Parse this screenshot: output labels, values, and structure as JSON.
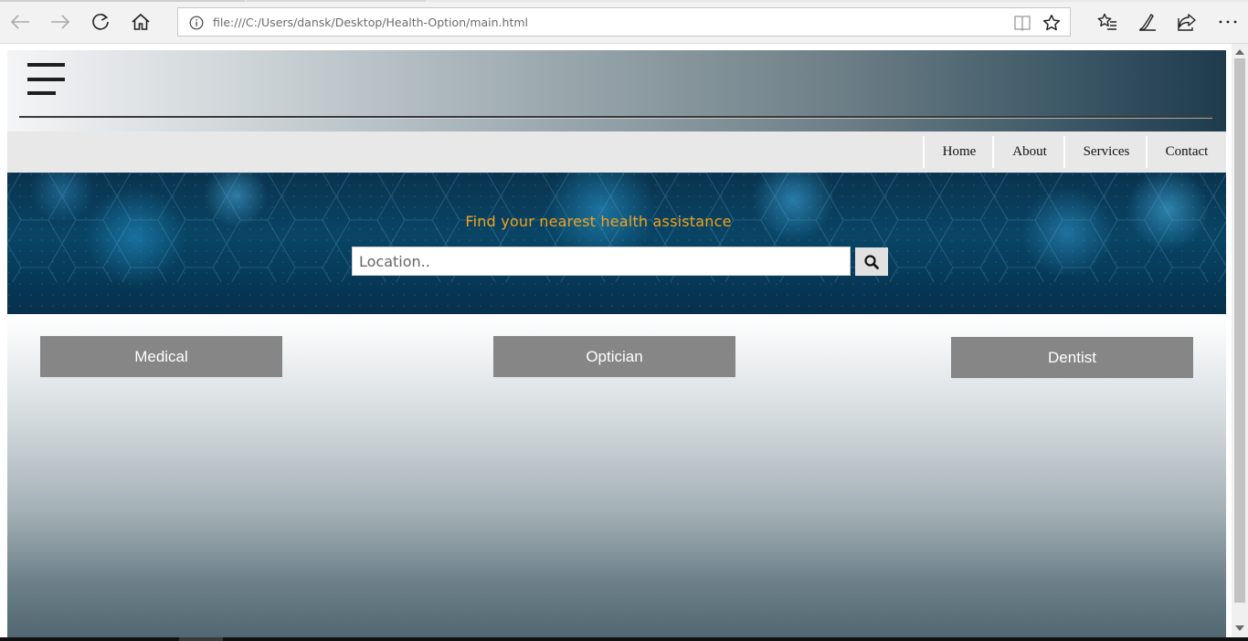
{
  "browser": {
    "url": "file:///C:/Users/dansk/Desktop/Health-Option/main.html",
    "icons": [
      "back-icon",
      "forward-icon",
      "refresh-icon",
      "home-icon",
      "info-icon",
      "reading-view-icon",
      "favorite-star-icon",
      "favorites-hub-icon",
      "pen-icon",
      "share-icon",
      "more-icon"
    ]
  },
  "header": {
    "menu_icon": "hamburger-icon"
  },
  "nav": {
    "items": [
      {
        "label": "Home"
      },
      {
        "label": "About"
      },
      {
        "label": "Services"
      },
      {
        "label": "Contact"
      }
    ]
  },
  "banner": {
    "title": "Find your nearest health assistance",
    "search_placeholder": "Location..",
    "search_icon": "search-icon"
  },
  "categories": [
    {
      "label": "Medical"
    },
    {
      "label": "Optician"
    },
    {
      "label": "Dentist"
    }
  ],
  "colors": {
    "banner_title": "#f2a21a",
    "banner_bg": "#0a4a6c",
    "category_button": "#868686",
    "nav_strip": "#e8e8e8"
  }
}
